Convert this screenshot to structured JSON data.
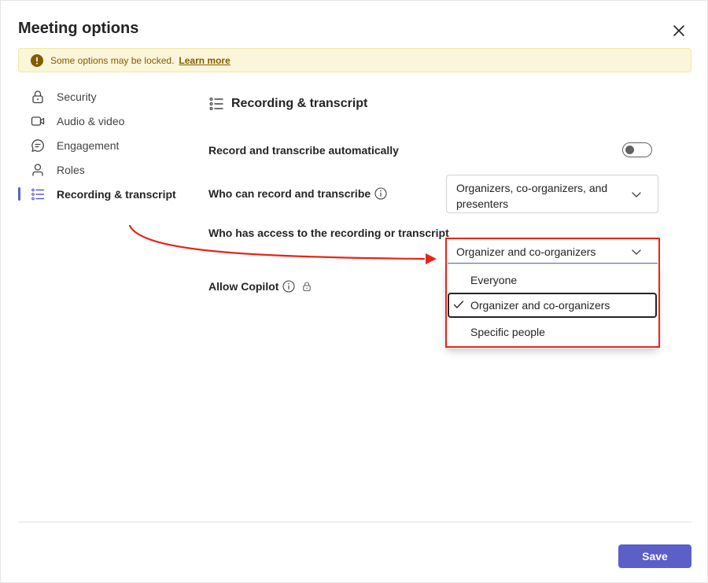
{
  "dialog": {
    "title": "Meeting options",
    "close_icon": "close-icon"
  },
  "banner": {
    "icon": "warning-icon",
    "text": "Some options may be locked.",
    "link": "Learn more",
    "background": "#fbf6d9",
    "text_color": "#835b00"
  },
  "sidebar": {
    "items": [
      {
        "label": "Security",
        "icon": "lock-icon",
        "active": false
      },
      {
        "label": "Audio & video",
        "icon": "video-camera-icon",
        "active": false
      },
      {
        "label": "Engagement",
        "icon": "chat-bubble-icon",
        "active": false
      },
      {
        "label": "Roles",
        "icon": "person-icon",
        "active": false
      },
      {
        "label": "Recording & transcript",
        "icon": "list-icon",
        "active": true
      }
    ]
  },
  "section": {
    "title": "Recording & transcript",
    "icon": "list-icon"
  },
  "settings": {
    "record_auto": {
      "label": "Record and transcribe automatically",
      "toggle_on": false
    },
    "who_can_record": {
      "label": "Who can record and transcribe",
      "value": "Organizers, co-organizers, and presenters"
    },
    "who_has_access": {
      "label": "Who has access to the recording or transcript",
      "value": "Organizer and co-organizers",
      "options": [
        "Everyone",
        "Organizer and co-organizers",
        "Specific people"
      ],
      "selected": "Organizer and co-organizers"
    },
    "allow_copilot": {
      "label": "Allow Copilot"
    }
  },
  "footer": {
    "save_label": "Save"
  },
  "colors": {
    "accent": "#5b5fc7",
    "annotation_red": "#e5251a"
  }
}
